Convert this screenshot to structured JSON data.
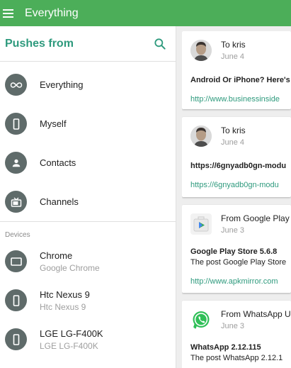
{
  "appbar": {
    "title": "Everything"
  },
  "drawer": {
    "title": "Pushes from",
    "items": [
      {
        "label": "Everything",
        "icon": "infinity-icon"
      },
      {
        "label": "Myself",
        "icon": "phone-icon"
      },
      {
        "label": "Contacts",
        "icon": "person-icon"
      },
      {
        "label": "Channels",
        "icon": "tv-icon"
      }
    ],
    "devices_header": "Devices",
    "devices": [
      {
        "name": "Chrome",
        "sub": "Google Chrome",
        "icon": "browser-window-icon"
      },
      {
        "name": "Htc Nexus 9",
        "sub": "Htc Nexus 9",
        "icon": "phone-icon"
      },
      {
        "name": "LGE LG-F400K",
        "sub": "LGE LG-F400K",
        "icon": "phone-icon"
      }
    ]
  },
  "feed": {
    "cards": [
      {
        "from": "To kris",
        "date": "June 4",
        "body": "Android Or iPhone? Here's",
        "link": "http://www.businessinside"
      },
      {
        "from": "To kris",
        "date": "June 4",
        "body": "https://6gnyadb0gn-modu",
        "link": "https://6gnyadb0gn-modu"
      },
      {
        "from": "From Google Play",
        "date": "June 3",
        "body": "Google Play Store 5.6.8",
        "desc": "The post Google Play Store",
        "link": "http://www.apkmirror.com"
      },
      {
        "from": "From WhatsApp U",
        "date": "June 3",
        "body": "WhatsApp 2.12.115",
        "desc": "The post WhatsApp 2.12.1"
      }
    ]
  },
  "colors": {
    "appbar": "#4cae59",
    "accent": "#2e9a7d",
    "icon_circle": "#5f6b6a"
  }
}
